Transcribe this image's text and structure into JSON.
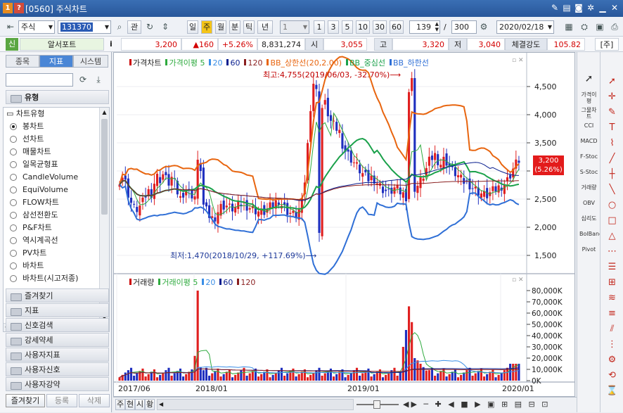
{
  "window": {
    "badge1": "1",
    "badge2": "?",
    "title": "[0560] 주식차트",
    "ctrl_icons": [
      "memo-icon",
      "save-icon",
      "camera-icon",
      "gear-icon",
      "minimize-icon",
      "maximize-icon",
      "close-icon"
    ]
  },
  "toolbar": {
    "market": "주식",
    "code": "131370",
    "gwan": "관",
    "periods": [
      "일",
      "주",
      "월",
      "분",
      "틱",
      "년"
    ],
    "active_period": "주",
    "interval_select": "1",
    "intervals": [
      "1",
      "3",
      "5",
      "10",
      "30",
      "60"
    ],
    "count": "139",
    "slash": "/",
    "total": "300",
    "date": "2020/02/18"
  },
  "quote": {
    "badge": "신",
    "name": "알서포트",
    "info": "i",
    "price": "3,200",
    "change": "▲160",
    "rate": "+5.26%",
    "volume": "8,831,274",
    "open_label": "시",
    "open": "3,055",
    "high_label": "고",
    "high": "3,320",
    "low_label": "저",
    "low": "3,040",
    "strength_label": "체결강도",
    "strength": "105.82",
    "period_tag": "[주]"
  },
  "left_panel": {
    "tabs": [
      "종목",
      "지표",
      "시스템"
    ],
    "active_tab": "지표",
    "section": "유형",
    "tree_root": "차트유형",
    "chart_types": [
      "봉차트",
      "선차트",
      "매물차트",
      "일목균형표",
      "CandleVolume",
      "EquiVolume",
      "FLOW차트",
      "삼선전환도",
      "P&F차트",
      "역시계곡선",
      "PV차트",
      "바차트",
      "바차트(시고저종)"
    ],
    "selected_type": "봉차트",
    "folders": [
      "즐겨찾기",
      "지표",
      "신호검색",
      "강세약세",
      "사용자지표",
      "사용자신호",
      "사용자강약"
    ],
    "bottom_tabs": [
      "즐겨찾기",
      "등록",
      "삭제"
    ]
  },
  "price_panel": {
    "legend": [
      {
        "label": "가격차트",
        "color": "#cc0000"
      },
      {
        "label": "가격이평 5",
        "color": "#2eaa3e"
      },
      {
        "label": "20",
        "color": "#3a8ee6"
      },
      {
        "label": "60",
        "color": "#0a1f8f"
      },
      {
        "label": "120",
        "color": "#8a1f1f"
      },
      {
        "label": "BB_상한선(20,2.00)",
        "color": "#e8650f"
      },
      {
        "label": "BB_중심선",
        "color": "#1aa14a"
      },
      {
        "label": "BB_하한선",
        "color": "#2f6fd6"
      }
    ],
    "high_note": "최고:4,755(2019/06/03, -32.70%)",
    "low_note": "최저:1,470(2018/10/29, +117.69%)",
    "y_ticks": [
      "4,500",
      "4,000",
      "3,500",
      "3,000",
      "2,500",
      "2,000",
      "1,500"
    ],
    "last_price": "3,200",
    "last_rate": "(5.26%)"
  },
  "volume_panel": {
    "legend": [
      {
        "label": "거래량",
        "color": "#cc0000"
      },
      {
        "label": "거래이평 5",
        "color": "#2eaa3e"
      },
      {
        "label": "20",
        "color": "#3a8ee6"
      },
      {
        "label": "60",
        "color": "#0a1f8f"
      },
      {
        "label": "120",
        "color": "#8a1f1f"
      }
    ],
    "y_ticks": [
      "80,000K",
      "70,000K",
      "60,000K",
      "50,000K",
      "40,000K",
      "30,000K",
      "20,000K",
      "10,000K",
      "0K"
    ]
  },
  "x_axis": [
    "2017/06",
    "2018/01",
    "2019/01",
    "2020/01"
  ],
  "bottom_bar": {
    "buttons": [
      "주",
      "현",
      "시",
      "황"
    ]
  },
  "right_tools": [
    "가격이평",
    "그물차트",
    "CCI",
    "MACD",
    "F-Stoc",
    "S-Stoc",
    "거래량",
    "OBV",
    "심리도",
    "BolBand",
    "Pivot"
  ]
}
